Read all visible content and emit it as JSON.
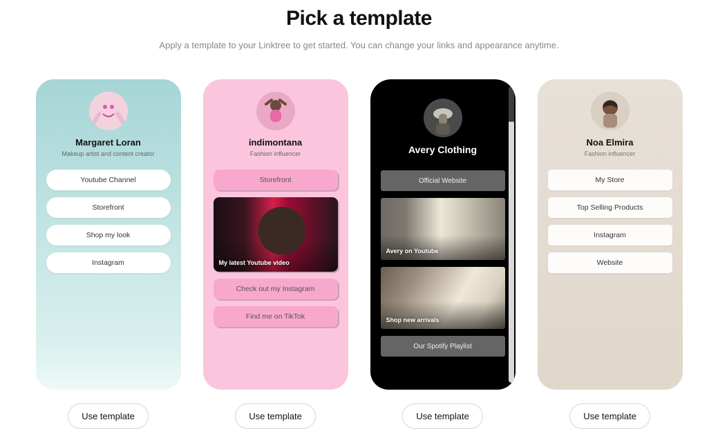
{
  "header": {
    "title": "Pick a template",
    "subtitle": "Apply a template to your Linktree to get started. You can change your links and appearance anytime."
  },
  "use_template_label": "Use template",
  "templates": [
    {
      "name": "Margaret Loran",
      "tagline": "Makeup artist and content creator",
      "links": [
        "Youtube Channel",
        "Storefront",
        "Shop my look",
        "Instagram"
      ]
    },
    {
      "name": "indimontana",
      "tagline": "Fashion influencer",
      "links": [
        "Storefront",
        "Check out my Instagram",
        "Find me on TikTok"
      ],
      "media_caption": "My latest Youtube video"
    },
    {
      "name": "Avery Clothing",
      "tagline": "",
      "links": [
        "Official Website",
        "Our Spotify Playlist"
      ],
      "media1_caption": "Avery on Youtube",
      "media2_caption": "Shop new arrivals"
    },
    {
      "name": "Noa Elmira",
      "tagline": "Fashion influencer",
      "links": [
        "My Store",
        "Top Selling Products",
        "Instagram",
        "Website"
      ]
    }
  ]
}
